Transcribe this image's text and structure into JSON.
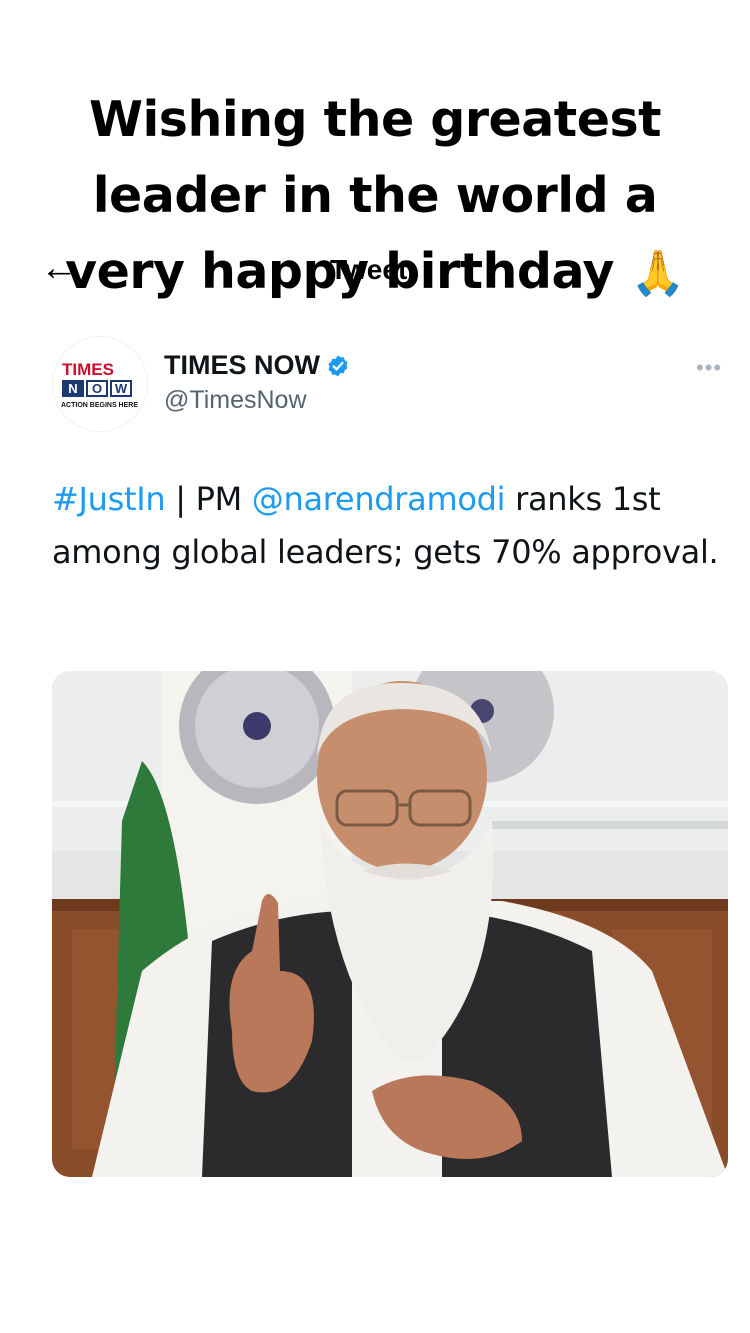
{
  "caption": {
    "line1": "Wishing the greatest",
    "line2": "leader in the world a",
    "line3": "very happy birthday",
    "emoji": "🙏"
  },
  "nav": {
    "back_icon": "←",
    "title": "Tweet"
  },
  "tweet": {
    "avatar_logo": {
      "times": "TIMES",
      "now": [
        "N",
        "O",
        "W"
      ],
      "tagline": "ACTION BEGINS HERE"
    },
    "display_name": "TIMES NOW",
    "handle": "@TimesNow",
    "more_icon": "•••",
    "text": {
      "hashtag": "#JustIn",
      "separator": " | PM ",
      "mention": "@narendramodi",
      "rest": " ranks 1st among global leaders; gets 70% approval."
    },
    "link_color": "#1d9bf0",
    "verified_color": "#1d9bf0"
  }
}
